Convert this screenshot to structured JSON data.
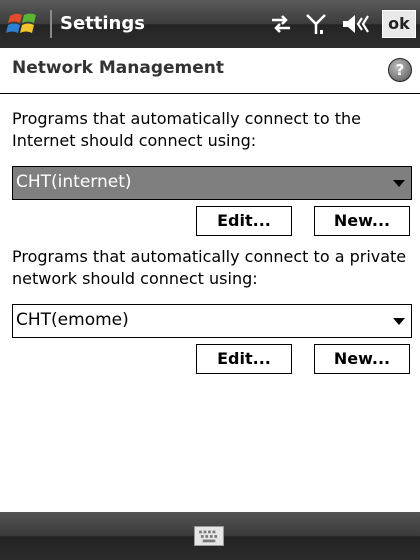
{
  "titlebar": {
    "title": "Settings",
    "icons": [
      "windows-start-icon",
      "connectivity-icon",
      "signal-icon",
      "volume-icon"
    ],
    "ok_label": "ok"
  },
  "header": {
    "title": "Network Management",
    "help_label": "?"
  },
  "internet": {
    "label": "Programs that automatically connect to the Internet should connect using:",
    "selected": "CHT(internet)",
    "edit_label": "Edit...",
    "new_label": "New..."
  },
  "private": {
    "label": "Programs that automatically connect to a private network should connect using:",
    "selected": "CHT(emome)",
    "edit_label": "Edit...",
    "new_label": "New..."
  },
  "bottombar": {
    "icons": [
      "keyboard-icon"
    ]
  }
}
